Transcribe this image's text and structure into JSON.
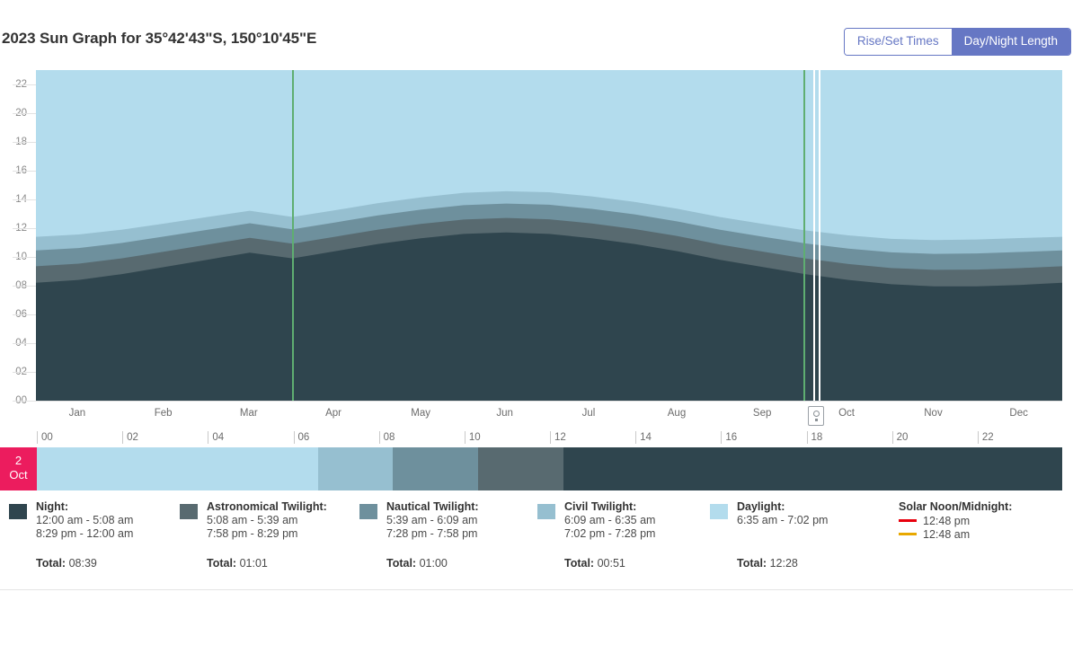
{
  "header": {
    "title": "2023 Sun Graph for 35°42'43\"S, 150°10'45\"E",
    "toggle": {
      "rise_set_label": "Rise/Set Times",
      "day_night_label": "Day/Night Length",
      "active": "Day/Night Length"
    }
  },
  "colors": {
    "night": "#2f454e",
    "astronomical": "#586a70",
    "nautical": "#6e909d",
    "civil": "#96bfd0",
    "daylight": "#b3dced",
    "dst_line": "#5fae71",
    "selection_line": "#ffffff",
    "badge": "#ec1c5e",
    "solar_noon": "#e8000d",
    "solar_midnight": "#e8a800",
    "accent": "#6677c4"
  },
  "selected_day": {
    "day": "2",
    "month": "Oct",
    "segments": [
      {
        "name": "daylight",
        "hours": 6.58
      },
      {
        "name": "civil",
        "hours": 1.75
      },
      {
        "name": "nautical",
        "hours": 2.0
      },
      {
        "name": "astronomical",
        "hours": 2.0
      },
      {
        "name": "night",
        "hours": 11.67
      }
    ]
  },
  "legend": [
    {
      "key": "night",
      "title": "Night:",
      "swatch": "#2f454e",
      "lines": [
        "12:00 am - 5:08 am",
        "8:29 pm - 12:00 am"
      ],
      "total_label": "Total:",
      "total": "08:39"
    },
    {
      "key": "astronomical",
      "title": "Astronomical Twilight:",
      "swatch": "#586a70",
      "lines": [
        "5:08 am - 5:39 am",
        "7:58 pm - 8:29 pm"
      ],
      "total_label": "Total:",
      "total": "01:01"
    },
    {
      "key": "nautical",
      "title": "Nautical Twilight:",
      "swatch": "#6e909d",
      "lines": [
        "5:39 am - 6:09 am",
        "7:28 pm - 7:58 pm"
      ],
      "total_label": "Total:",
      "total": "01:00"
    },
    {
      "key": "civil",
      "title": "Civil Twilight:",
      "swatch": "#96bfd0",
      "lines": [
        "6:09 am - 6:35 am",
        "7:02 pm - 7:28 pm"
      ],
      "total_label": "Total:",
      "total": "00:51"
    },
    {
      "key": "daylight",
      "title": "Daylight:",
      "swatch": "#b3dced",
      "lines": [
        "6:35 am - 7:02 pm",
        ""
      ],
      "total_label": "Total:",
      "total": "12:28"
    }
  ],
  "solar": {
    "title": "Solar Noon/Midnight:",
    "noon_time": "12:48 pm",
    "midnight_time": "12:48 am",
    "noon_color": "#e8000d",
    "midnight_color": "#e8a800"
  },
  "chart_data": {
    "type": "area",
    "title": "2023 Sun Graph for 35°42'43\"S, 150°10'45\"E",
    "xlabel": "",
    "ylabel": "",
    "ylim": [
      0,
      23
    ],
    "grid": true,
    "legend_position": "bottom",
    "y_ticks": [
      "00",
      "02",
      "04",
      "06",
      "08",
      "10",
      "12",
      "14",
      "16",
      "18",
      "20",
      "22"
    ],
    "x_months": [
      "Jan",
      "Feb",
      "Mar",
      "Apr",
      "May",
      "Jun",
      "Jul",
      "Aug",
      "Sep",
      "Oct",
      "Nov",
      "Dec"
    ],
    "x_hours": [
      "00",
      "02",
      "04",
      "06",
      "08",
      "10",
      "12",
      "14",
      "16",
      "18",
      "20",
      "22"
    ],
    "x": [
      "Jan 1",
      "Jan 15",
      "Feb 1",
      "Feb 15",
      "Mar 1",
      "Mar 15",
      "Apr 1",
      "Apr 15",
      "May 1",
      "May 15",
      "Jun 1",
      "Jun 15",
      "Jul 1",
      "Jul 15",
      "Aug 1",
      "Aug 15",
      "Sep 1",
      "Sep 15",
      "Oct 1",
      "Oct 15",
      "Nov 1",
      "Nov 15",
      "Dec 1",
      "Dec 15",
      "Dec 31"
    ],
    "series": [
      {
        "name": "Night",
        "color": "#2f454e",
        "values": [
          8.2,
          8.4,
          8.8,
          9.3,
          9.8,
          10.3,
          9.9,
          10.4,
          10.9,
          11.3,
          11.6,
          11.7,
          11.6,
          11.3,
          10.9,
          10.4,
          9.8,
          9.3,
          8.8,
          8.4,
          8.1,
          7.95,
          7.95,
          8.05,
          8.2
        ]
      },
      {
        "name": "Astronomical Twilight",
        "color": "#586a70",
        "values": [
          1.15,
          1.13,
          1.1,
          1.07,
          1.05,
          1.03,
          1.02,
          1.01,
          1.0,
          1.0,
          1.0,
          1.01,
          1.02,
          1.03,
          1.04,
          1.05,
          1.06,
          1.07,
          1.09,
          1.11,
          1.13,
          1.15,
          1.17,
          1.17,
          1.15
        ]
      },
      {
        "name": "Nautical Twilight",
        "color": "#6e909d",
        "values": [
          1.1,
          1.09,
          1.07,
          1.05,
          1.03,
          1.01,
          1.0,
          0.99,
          0.99,
          0.99,
          1.0,
          1.0,
          1.01,
          1.01,
          1.02,
          1.02,
          1.03,
          1.04,
          1.05,
          1.07,
          1.09,
          1.11,
          1.12,
          1.12,
          1.1
        ]
      },
      {
        "name": "Civil Twilight",
        "color": "#96bfd0",
        "values": [
          0.95,
          0.94,
          0.92,
          0.9,
          0.89,
          0.87,
          0.86,
          0.85,
          0.85,
          0.85,
          0.86,
          0.86,
          0.87,
          0.87,
          0.87,
          0.88,
          0.88,
          0.89,
          0.9,
          0.92,
          0.94,
          0.96,
          0.97,
          0.97,
          0.95
        ]
      },
      {
        "name": "Daylight",
        "color": "#b3dced",
        "values": [
          12.6,
          12.44,
          12.11,
          11.68,
          11.23,
          10.79,
          11.22,
          10.75,
          10.26,
          9.86,
          9.54,
          9.43,
          9.5,
          9.79,
          10.18,
          10.65,
          11.23,
          11.7,
          12.16,
          12.5,
          12.74,
          12.83,
          12.79,
          12.69,
          12.6
        ]
      }
    ],
    "dst_lines": [
      "Apr 2",
      "Oct 1"
    ],
    "selection_line": "Oct 2"
  }
}
